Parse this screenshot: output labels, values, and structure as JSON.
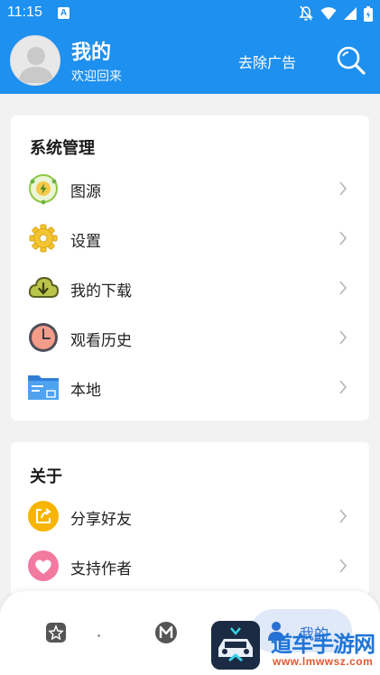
{
  "status_bar": {
    "time": "11:15",
    "badge": "A"
  },
  "header": {
    "title": "我的",
    "subtitle": "欢迎回来",
    "remove_ads": "去除广告"
  },
  "system_section": {
    "title": "系统管理",
    "items": [
      {
        "label": "图源",
        "icon": "image-source-icon"
      },
      {
        "label": "设置",
        "icon": "gear-icon"
      },
      {
        "label": "我的下载",
        "icon": "download-cloud-icon"
      },
      {
        "label": "观看历史",
        "icon": "clock-icon"
      },
      {
        "label": "本地",
        "icon": "folder-icon"
      }
    ]
  },
  "about_section": {
    "title": "关于",
    "items": [
      {
        "label": "分享好友",
        "icon": "share-icon"
      },
      {
        "label": "支持作者",
        "icon": "heart-icon"
      }
    ]
  },
  "bottom_nav": {
    "mine_label": "我的"
  },
  "watermark": {
    "brand_text": "道车手游网",
    "url": "www.lmwwsz.com"
  },
  "colors": {
    "primary": "#1e90ef",
    "nav_pill": "#dfe9f8"
  }
}
